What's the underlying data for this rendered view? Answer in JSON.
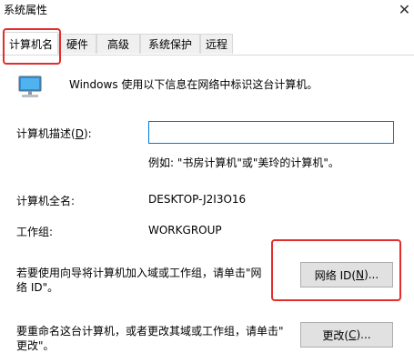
{
  "window": {
    "title": "系统属性",
    "close_glyph": "✕"
  },
  "tabs": [
    {
      "label": "计算机名",
      "active": true
    },
    {
      "label": "硬件"
    },
    {
      "label": "高级"
    },
    {
      "label": "系统保护"
    },
    {
      "label": "远程"
    }
  ],
  "intro": {
    "text": "Windows 使用以下信息在网络中标识这台计算机。",
    "icon": "computer-icon"
  },
  "description": {
    "label_prefix": "计算机描述(",
    "label_key": "D",
    "label_suffix": "):",
    "value": "",
    "hint": "例如: \"书房计算机\"或\"美玲的计算机\"。"
  },
  "fullname": {
    "label": "计算机全名:",
    "value": "DESKTOP-J2I3O16"
  },
  "workgroup": {
    "label": "工作组:",
    "value": "WORKGROUP"
  },
  "network": {
    "text_line1": "若要使用向导将计算机加入域或工作组，请单击\"网",
    "text_line2": "络 ID\"。",
    "button_prefix": "网络 ID(",
    "button_key": "N",
    "button_suffix": ")..."
  },
  "rename": {
    "text_line1": "要重命名这台计算机，或者更改其域或工作组，请单击\"",
    "text_line2": "更改\"。",
    "button_prefix": "更改(",
    "button_key": "C",
    "button_suffix": ")..."
  },
  "colors": {
    "highlight": "#e32d2d",
    "input_border": "#0078d7"
  }
}
